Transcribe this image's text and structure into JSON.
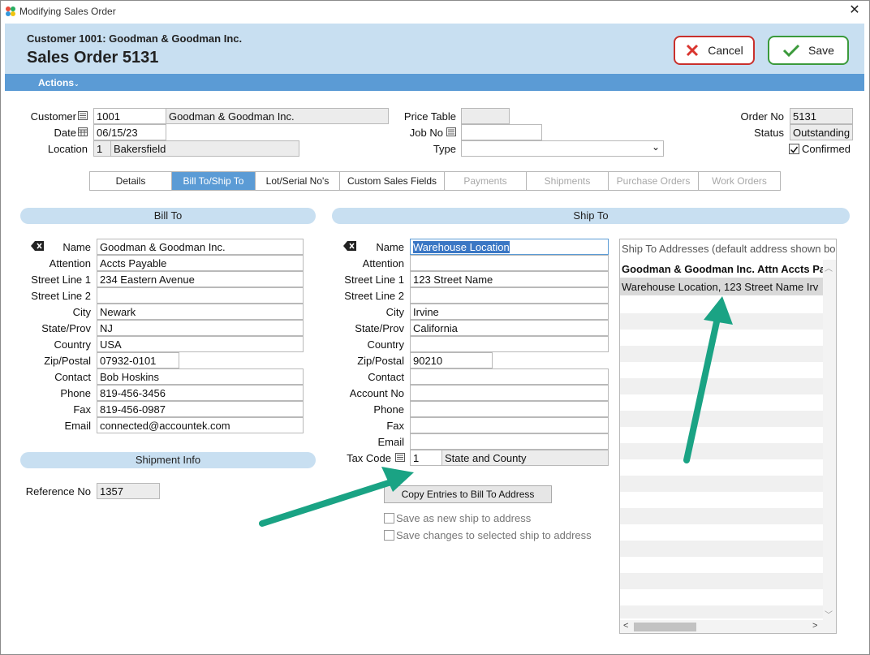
{
  "window": {
    "title": "Modifying Sales Order"
  },
  "header": {
    "customer_line": "Customer 1001: Goodman & Goodman Inc.",
    "order_title": "Sales Order 5131",
    "cancel_label": "Cancel",
    "save_label": "Save",
    "actions_label": "Actions"
  },
  "order": {
    "customer_label": "Customer",
    "customer_id": "1001",
    "customer_name": "Goodman & Goodman Inc.",
    "date_label": "Date",
    "date": "06/15/23",
    "location_label": "Location",
    "location_id": "1",
    "location_name": "Bakersfield",
    "price_table_label": "Price Table",
    "price_table": "",
    "job_no_label": "Job No",
    "job_no": "",
    "type_label": "Type",
    "type": "",
    "order_no_label": "Order No",
    "order_no": "5131",
    "status_label": "Status",
    "status": "Outstanding",
    "confirmed_label": "Confirmed",
    "confirmed": true
  },
  "tabs": [
    {
      "label": "Details",
      "state": "normal"
    },
    {
      "label": "Bill To/Ship To",
      "state": "active"
    },
    {
      "label": "Lot/Serial No's",
      "state": "normal"
    },
    {
      "label": "Custom Sales Fields",
      "state": "normal"
    },
    {
      "label": "Payments",
      "state": "disabled"
    },
    {
      "label": "Shipments",
      "state": "disabled"
    },
    {
      "label": "Purchase Orders",
      "state": "disabled"
    },
    {
      "label": "Work Orders",
      "state": "disabled"
    }
  ],
  "bill_to": {
    "section_title": "Bill To",
    "fields": [
      {
        "label": "Name",
        "value": "Goodman & Goodman Inc."
      },
      {
        "label": "Attention",
        "value": "Accts Payable"
      },
      {
        "label": "Street Line 1",
        "value": "234 Eastern Avenue"
      },
      {
        "label": "Street Line 2",
        "value": ""
      },
      {
        "label": "City",
        "value": "Newark"
      },
      {
        "label": "State/Prov",
        "value": "NJ"
      },
      {
        "label": "Country",
        "value": "USA"
      },
      {
        "label": "Zip/Postal",
        "value": "07932-0101"
      },
      {
        "label": "Contact",
        "value": "Bob Hoskins"
      },
      {
        "label": "Phone",
        "value": "819-456-3456"
      },
      {
        "label": "Fax",
        "value": "819-456-0987"
      },
      {
        "label": "Email",
        "value": "connected@accountek.com"
      }
    ]
  },
  "shipment_info": {
    "section_title": "Shipment Info",
    "reference_label": "Reference No",
    "reference_no": "1357"
  },
  "ship_to": {
    "section_title": "Ship To",
    "fields": [
      {
        "label": "Name",
        "value": "Warehouse Location"
      },
      {
        "label": "Attention",
        "value": ""
      },
      {
        "label": "Street Line 1",
        "value": "123 Street Name"
      },
      {
        "label": "Street Line 2",
        "value": ""
      },
      {
        "label": "City",
        "value": "Irvine"
      },
      {
        "label": "State/Prov",
        "value": "California"
      },
      {
        "label": "Country",
        "value": ""
      },
      {
        "label": "Zip/Postal",
        "value": "90210"
      },
      {
        "label": "Contact",
        "value": ""
      },
      {
        "label": "Account No",
        "value": ""
      },
      {
        "label": "Phone",
        "value": ""
      },
      {
        "label": "Fax",
        "value": ""
      },
      {
        "label": "Email",
        "value": ""
      }
    ],
    "tax_code_label": "Tax Code",
    "tax_code": "1",
    "tax_code_desc": "State and County",
    "copy_button": "Copy Entries to Bill To Address",
    "save_new_label": "Save as new ship to address",
    "save_changes_label": "Save changes to selected ship to address"
  },
  "ship_to_addresses": {
    "header": "Ship To Addresses (default address shown bo",
    "rows": [
      "Goodman & Goodman Inc. Attn Accts Pa",
      "Warehouse Location, 123 Street Name  Irv"
    ]
  },
  "colors": {
    "accent": "#5b9bd5",
    "header_bg": "#c8dff1",
    "annotation_arrow": "#1aa384"
  }
}
